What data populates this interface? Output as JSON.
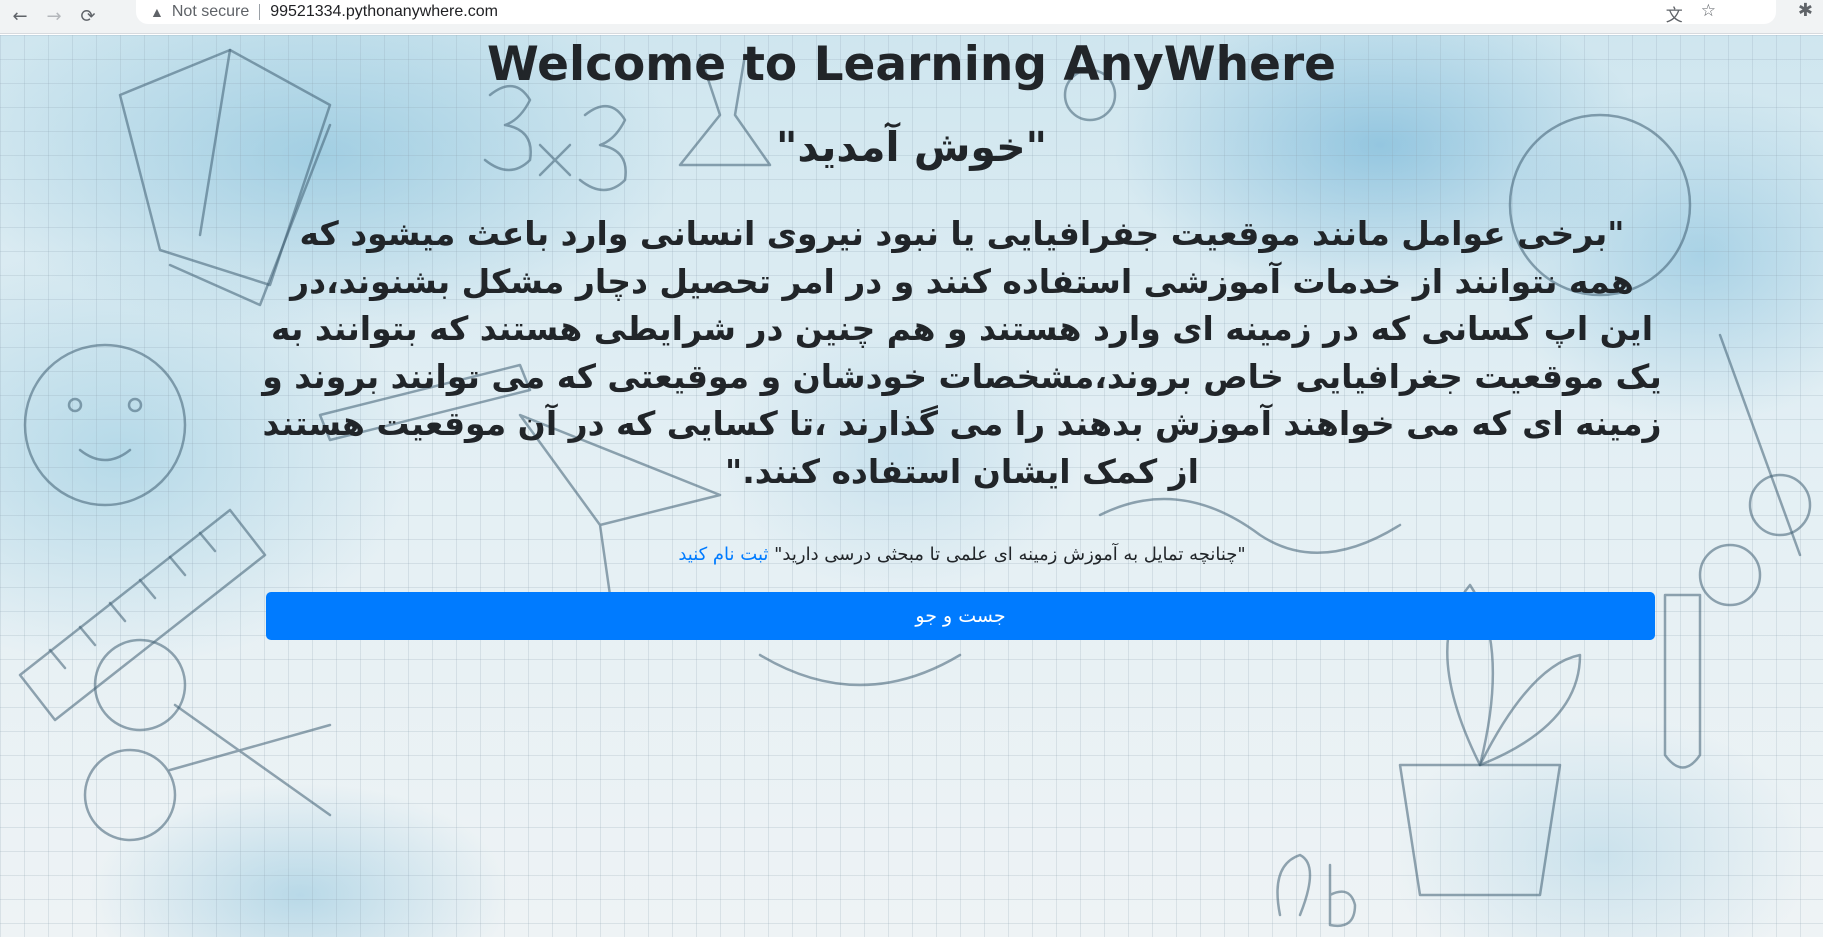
{
  "browser": {
    "back_icon": "←",
    "forward_icon": "→",
    "reload_icon": "⟳",
    "security_label": "Not secure",
    "url": "99521334.pythonanywhere.com",
    "translate_icon": "文",
    "star_icon": "☆",
    "extensions_icon": "✱"
  },
  "page": {
    "title": "Welcome to Learning AnyWhere",
    "welcome_fa": "\"خوش آمدید\"",
    "paragraph": "\"برخی عوامل مانند موقعیت جفرافیایی یا نبود نیروی انسانی وارد باعث میشود که همه نتوانند از خدمات آموزشی استفاده کنند و در امر تحصیل دچار مشکل بشنوند،در این اپ کسانی که در زمینه ای وارد هستند و هم چنین در شرایطی هستند که بتوانند به یک موقعیت جغرافیایی خاص بروند،مشخصات خودشان و موقیعتی که می توانند بروند و زمینه ای که می خواهند آموزش بدهند را می گذارند ،تا کسایی که در آن موقعیت هستند از کمک ایشان استفاده کنند.\"",
    "signup_prefix": "\"چنانچه تمایل به آموزش زمینه ای علمی تا مبحثی درسی دارید\"",
    "signup_link": "ثبت نام کنید",
    "search_button": "جست و جو"
  },
  "colors": {
    "primary": "#007bff",
    "text": "#212529"
  }
}
